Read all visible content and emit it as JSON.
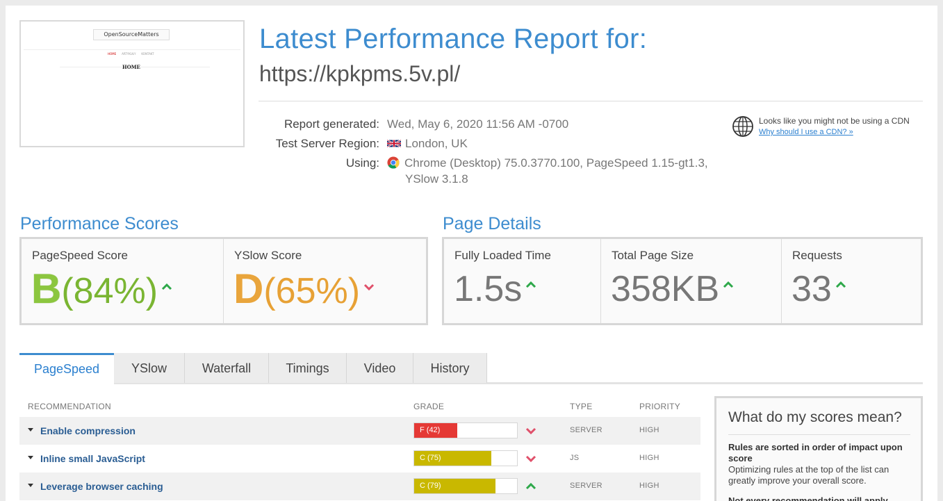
{
  "thumbnail": {
    "logo": "OpenSourceMatters",
    "nav": [
      "HOME",
      "ARTYKUŁY",
      "KONTAKT"
    ],
    "heading": "HOME"
  },
  "header": {
    "title": "Latest Performance Report for:",
    "url": "https://kpkpms.5v.pl/"
  },
  "meta": {
    "generated_label": "Report generated:",
    "generated_value": "Wed, May 6, 2020 11:56 AM -0700",
    "region_label": "Test Server Region:",
    "region_value": "London, UK",
    "using_label": "Using:",
    "using_value_line1": "Chrome (Desktop) 75.0.3770.100, PageSpeed 1.15-gt1.3,",
    "using_value_line2": "YSlow 3.1.8"
  },
  "cdn": {
    "text": "Looks like you might not be using a CDN",
    "link": "Why should I use a CDN? »"
  },
  "performance": {
    "title": "Performance Scores",
    "pagespeed": {
      "label": "PageSpeed Score",
      "grade": "B",
      "percent": "(84%)",
      "trend": "up",
      "color": "#7ab532"
    },
    "yslow": {
      "label": "YSlow Score",
      "grade": "D",
      "percent": "(65%)",
      "trend": "down",
      "color": "#e7a135"
    }
  },
  "details": {
    "title": "Page Details",
    "loaded": {
      "label": "Fully Loaded Time",
      "value": "1.5s"
    },
    "size": {
      "label": "Total Page Size",
      "value": "358KB"
    },
    "requests": {
      "label": "Requests",
      "value": "33"
    }
  },
  "tabs": [
    "PageSpeed",
    "YSlow",
    "Waterfall",
    "Timings",
    "Video",
    "History"
  ],
  "table": {
    "headers": {
      "recommendation": "RECOMMENDATION",
      "grade": "GRADE",
      "type": "TYPE",
      "priority": "PRIORITY"
    },
    "rows": [
      {
        "name": "Enable compression",
        "grade": "F (42)",
        "score": 42,
        "color": "#e53935",
        "trend": "down",
        "type": "SERVER",
        "priority": "HIGH"
      },
      {
        "name": "Inline small JavaScript",
        "grade": "C (75)",
        "score": 75,
        "color": "#c9b800",
        "trend": "down",
        "type": "JS",
        "priority": "HIGH"
      },
      {
        "name": "Leverage browser caching",
        "grade": "C (79)",
        "score": 79,
        "color": "#c9b800",
        "trend": "up",
        "type": "SERVER",
        "priority": "HIGH"
      }
    ]
  },
  "sidebox": {
    "title": "What do my scores mean?",
    "bold1": "Rules are sorted in order of impact upon score",
    "text1": "Optimizing rules at the top of the list can greatly improve your overall score.",
    "bold2": "Not every recommendation will apply"
  }
}
